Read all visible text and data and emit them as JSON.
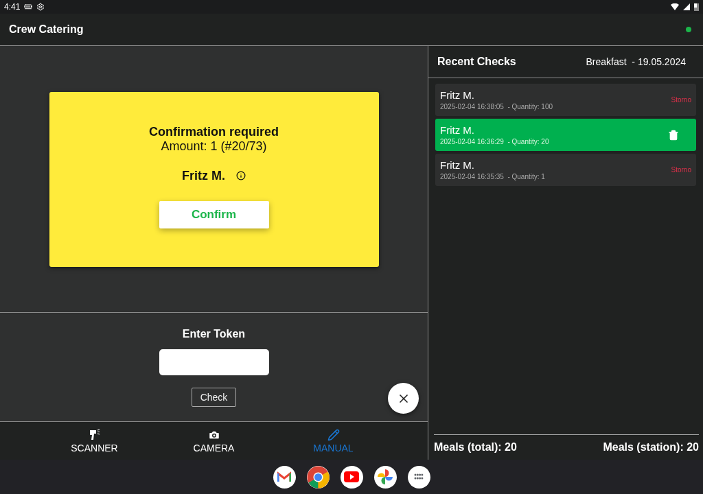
{
  "status_bar": {
    "time": "4:41"
  },
  "app_bar": {
    "title": "Crew Catering",
    "online": true
  },
  "confirmation": {
    "title": "Confirmation required",
    "amount": "Amount: 1 (#20/73)",
    "name": "Fritz M.",
    "button": "Confirm"
  },
  "token_entry": {
    "label": "Enter Token",
    "button": "Check"
  },
  "bottom_nav": [
    {
      "kind": "scanner",
      "label": "SCANNER",
      "selected": false
    },
    {
      "kind": "camera",
      "label": "CAMERA",
      "selected": false
    },
    {
      "kind": "manual",
      "label": "MANUAL",
      "selected": true
    }
  ],
  "recent_checks": {
    "title": "Recent Checks",
    "meal": "Breakfast  - 19.05.2024",
    "items": [
      {
        "name": "Fritz M.",
        "details": "2025-02-04 16:38:05  - Quantity: 100",
        "action": "Storno",
        "selected": false
      },
      {
        "name": "Fritz M.",
        "details": "2025-02-04 16:36:29  - Quantity: 20",
        "selected": true
      },
      {
        "name": "Fritz M.",
        "details": "2025-02-04 16:35:35  - Quantity: 1",
        "action": "Storno",
        "selected": false
      }
    ],
    "total": "Meals (total): 20",
    "station": "Meals (station): 20"
  },
  "taskbar": [
    {
      "kind": "mail"
    },
    {
      "kind": "browser"
    },
    {
      "kind": "video"
    },
    {
      "kind": "photos"
    },
    {
      "kind": "apps"
    }
  ]
}
